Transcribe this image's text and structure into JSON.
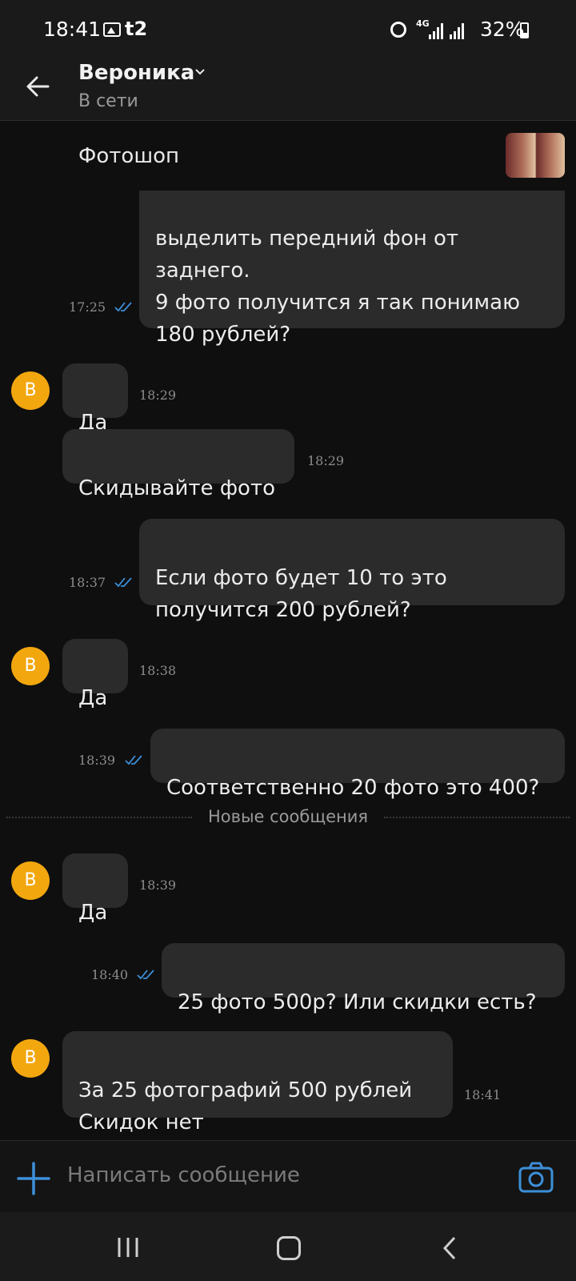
{
  "status_bar": {
    "time": "18:41",
    "carrier": "t2",
    "network": "4G",
    "battery": "32%",
    "battery_level": 0.32,
    "icons": [
      "gallery-icon",
      "alarm-icon",
      "signal-icon",
      "battery-icon"
    ]
  },
  "header": {
    "contact_name": "Вероника",
    "presence": "В сети"
  },
  "pinned": {
    "title": "Фотошоп"
  },
  "messages": [
    {
      "id": "m1",
      "direction": "out",
      "text": "выделить передний фон от\nзаднего.\n9 фото получится я так понимаю\n180 рублей?",
      "time": "17:25",
      "read": true
    },
    {
      "id": "m2",
      "direction": "in",
      "avatar": "В",
      "text": "Да",
      "time": "18:29"
    },
    {
      "id": "m3",
      "direction": "in",
      "text": "Скидывайте фото",
      "time": "18:29"
    },
    {
      "id": "m4",
      "direction": "out",
      "text": "Если фото будет 10 то это\nполучится 200 рублей?",
      "time": "18:37",
      "read": true
    },
    {
      "id": "m5",
      "direction": "in",
      "avatar": "В",
      "text": "Да",
      "time": "18:38"
    },
    {
      "id": "m6",
      "direction": "out",
      "text": "Соответственно 20 фото это 400?",
      "time": "18:39",
      "read": true
    },
    {
      "id": "m7",
      "direction": "in",
      "avatar": "В",
      "text": "Да",
      "time": "18:39"
    },
    {
      "id": "m8",
      "direction": "out",
      "text": "25 фото 500р? Или скидки есть?",
      "time": "18:40",
      "read": true
    },
    {
      "id": "m9",
      "direction": "in",
      "avatar": "В",
      "text": "За 25 фотографий 500 рублей\nСкидок нет",
      "time": "18:41"
    }
  ],
  "new_messages_divider": "Новые сообщения",
  "composer": {
    "placeholder": "Написать сообщение"
  },
  "colors": {
    "background": "#0f0f0f",
    "bubble": "#2b2b2b",
    "avatar": "#f2a70f",
    "accent": "#3d8fd9"
  }
}
